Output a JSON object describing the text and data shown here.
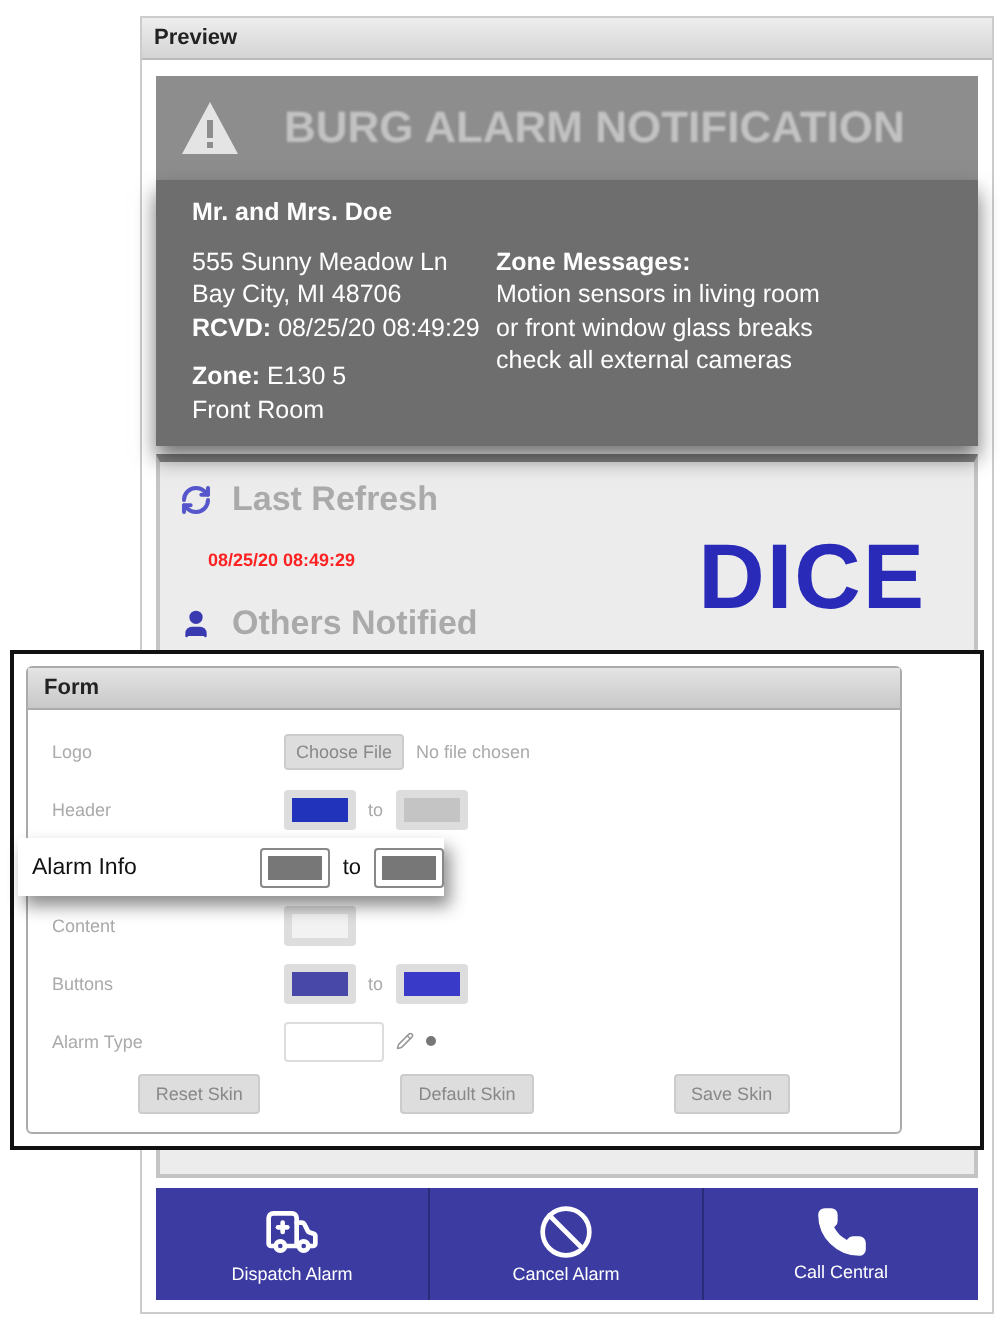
{
  "preview": {
    "title": "Preview",
    "alarm": {
      "title": "BURG ALARM NOTIFICATION",
      "name": "Mr. and Mrs. Doe",
      "address_lines": [
        "555 Sunny Meadow Ln",
        "Bay City, MI 48706"
      ],
      "rcvd_label": "RCVD:",
      "rcvd_value": "08/25/20 08:49:29",
      "zone_label": "Zone:",
      "zone_value": "E130 5",
      "zone_name": "Front Room",
      "messages_label": "Zone Messages:",
      "messages": [
        "Motion sensors in living room",
        "or front window glass breaks",
        "check all external cameras"
      ]
    },
    "status": [
      {
        "kind": "refresh",
        "label": "Last Refresh",
        "time": "08/25/20 08:49:29"
      },
      {
        "kind": "person",
        "label": "Others Notified"
      }
    ],
    "logo_text": "DICE",
    "actions": [
      {
        "kind": "ambulance",
        "label": "Dispatch Alarm"
      },
      {
        "kind": "cancel",
        "label": "Cancel Alarm"
      },
      {
        "kind": "phone",
        "label": "Call Central"
      }
    ]
  },
  "form": {
    "title": "Form",
    "rows": [
      {
        "kind": "file",
        "label": "Logo",
        "button": "Choose File",
        "note": "No file chosen",
        "highlighted": false
      },
      {
        "kind": "colors",
        "label": "Header",
        "swatches": [
          {
            "color": "#2233bb"
          },
          {
            "color": "#c4c4c4"
          }
        ],
        "connector": "to",
        "highlighted": false
      },
      {
        "kind": "colors",
        "label": "Alarm Info",
        "swatches": [
          {
            "color": "#777777"
          },
          {
            "color": "#777777"
          }
        ],
        "connector": "to",
        "highlighted": true
      },
      {
        "kind": "colors",
        "label": "Content",
        "swatches": [
          {
            "color": "#f2f2f2"
          }
        ],
        "highlighted": false
      },
      {
        "kind": "colors",
        "label": "Buttons",
        "swatches": [
          {
            "color": "#4848a8"
          },
          {
            "color": "#3a3ac8"
          }
        ],
        "connector": "to",
        "highlighted": false
      },
      {
        "kind": "text",
        "label": "Alarm Type",
        "highlighted": false
      }
    ],
    "buttons": [
      "Reset Skin",
      "Default Skin",
      "Save Skin"
    ]
  }
}
